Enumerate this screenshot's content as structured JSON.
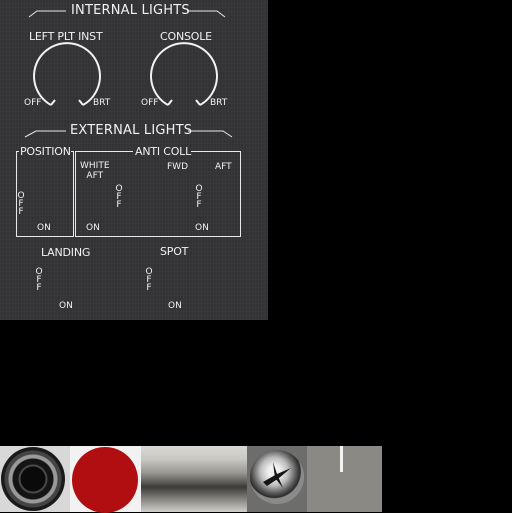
{
  "panel": {
    "internal_lights": {
      "title": "INTERNAL LIGHTS",
      "left_plt_inst": {
        "label": "LEFT PLT INST",
        "off": "OFF",
        "brt": "BRT"
      },
      "console": {
        "label": "CONSOLE",
        "off": "OFF",
        "brt": "BRT"
      }
    },
    "external_lights": {
      "title": "EXTERNAL LIGHTS",
      "position": {
        "label": "POSITION",
        "off": "O\nF\nF",
        "on": "ON"
      },
      "anti_coll": {
        "label": "ANTI COLL",
        "white_aft": "WHITE\nAFT",
        "fwd": "FWD",
        "aft": "AFT",
        "left_off": "O\nF\nF",
        "right_off": "O\nF\nF",
        "left_on": "ON",
        "right_on": "ON"
      },
      "landing": {
        "label": "LANDING",
        "off": "O\nF\nF",
        "on": "ON"
      },
      "spot": {
        "label": "SPOT",
        "off": "O\nF\nF",
        "on": "ON"
      }
    }
  },
  "textures": [
    {
      "name": "black-knob-texture",
      "color": "#1a1a1a"
    },
    {
      "name": "red-button-texture",
      "color": "#b00e10"
    },
    {
      "name": "metal-gradient-texture",
      "color": "#8a8a85"
    },
    {
      "name": "screw-texture",
      "color": "#6d6e6c"
    },
    {
      "name": "gray-indicator-texture",
      "color": "#8a8984"
    }
  ]
}
